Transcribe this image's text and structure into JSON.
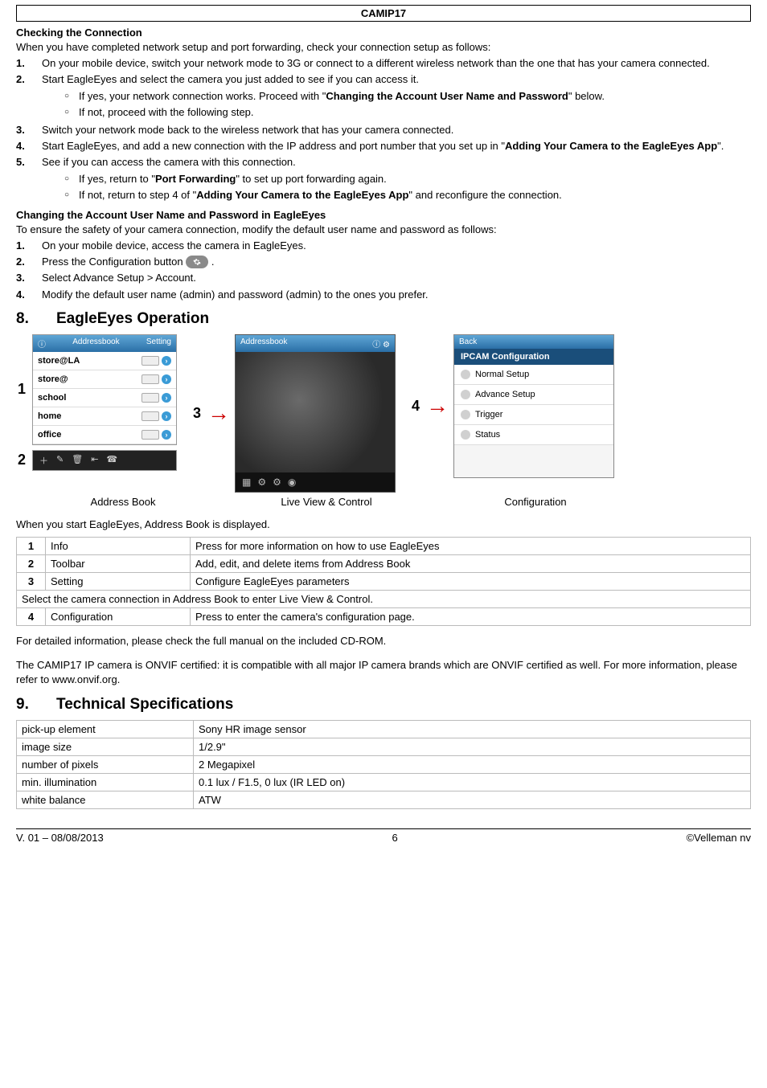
{
  "header": {
    "title": "CAMIP17"
  },
  "sectionA": {
    "title": "Checking the Connection",
    "intro": "When you have completed network setup and port forwarding, check your connection setup as follows:",
    "items": [
      {
        "n": "1.",
        "text": "On your mobile device, switch your network mode to 3G or connect to a different wireless network than the one that has your camera connected."
      },
      {
        "n": "2.",
        "text_before": "Start EagleEyes and select the camera you just added to see if you can access it.",
        "subs": [
          {
            "before": "If yes, your network connection works. Proceed with \"",
            "bold": "Changing the Account User Name and Password",
            "after": "\" below."
          },
          {
            "plain": "If not, proceed with the following step."
          }
        ]
      },
      {
        "n": "3.",
        "text": "Switch your network mode back to the wireless network that has your camera connected."
      },
      {
        "n": "4.",
        "text_before": "Start EagleEyes, and add a new connection with the IP address and port number that you set up in \"",
        "text_bold": "Adding Your Camera to the EagleEyes App",
        "text_after": "\"."
      },
      {
        "n": "5.",
        "text_before": "See if you can access the camera with this connection.",
        "subs": [
          {
            "before": "If yes, return to \"",
            "bold": "Port Forwarding",
            "after": "\" to set up port forwarding again."
          },
          {
            "before": "If not, return to step 4 of \"",
            "bold": "Adding Your Camera to the EagleEyes App",
            "after": "\" and reconfigure the connection."
          }
        ]
      }
    ]
  },
  "sectionB": {
    "title": "Changing the Account User Name and Password in EagleEyes",
    "intro": "To ensure the safety of your camera connection, modify the default user name and password as follows:",
    "items": [
      {
        "n": "1.",
        "text": "On your mobile device, access the camera in EagleEyes."
      },
      {
        "n": "2.",
        "text_before": "Press the Configuration button ",
        "has_icon": true,
        "text_after": "."
      },
      {
        "n": "3.",
        "text": "Select Advance Setup > Account."
      },
      {
        "n": "4.",
        "text": "Modify the default user name (admin) and password (admin) to the ones you prefer."
      }
    ]
  },
  "section8": {
    "num": "8.",
    "title": "EagleEyes Operation",
    "labels": {
      "l1": "1",
      "l2": "2",
      "l3": "3",
      "l4": "4"
    },
    "addressbook": {
      "title_left": "ⓘ",
      "title_mid": "Addressbook",
      "title_right": "Setting",
      "rows": [
        "store@LA",
        "store@",
        "school",
        "home",
        "office"
      ]
    },
    "liveview": {
      "title": "Addressbook"
    },
    "config": {
      "back": "Back",
      "hdr": "IPCAM Configuration",
      "items": [
        "Normal Setup",
        "Advance Setup",
        "Trigger",
        "Status"
      ]
    },
    "captions": {
      "c1": "Address Book",
      "c2": "Live View & Control",
      "c3": "Configuration"
    },
    "para": "When you start EagleEyes, Address Book is displayed.",
    "table": {
      "rows": [
        {
          "n": "1",
          "name": "Info",
          "desc": "Press for more information on how to use EagleEyes"
        },
        {
          "n": "2",
          "name": "Toolbar",
          "desc": "Add, edit, and delete items from Address Book"
        },
        {
          "n": "3",
          "name": "Setting",
          "desc": "Configure EagleEyes parameters"
        }
      ],
      "span": "Select the camera connection in Address Book to enter Live View & Control.",
      "last": {
        "n": "4",
        "name": "Configuration",
        "desc": "Press to enter the camera's configuration page."
      }
    },
    "after1": "For detailed information, please check the full manual on the included CD-ROM.",
    "after2": "The CAMIP17 IP camera is ONVIF certified: it is compatible with all major IP camera brands which are ONVIF certified as well. For more information, please refer to www.onvif.org."
  },
  "section9": {
    "num": "9.",
    "title": "Technical Specifications",
    "rows": [
      {
        "k": "pick-up element",
        "v": "Sony HR image sensor"
      },
      {
        "k": "image size",
        "v": "1/2.9\""
      },
      {
        "k": "number of pixels",
        "v": "2 Megapixel"
      },
      {
        "k": "min. illumination",
        "v": "0.1 lux / F1.5, 0 lux (IR LED on)"
      },
      {
        "k": "white balance",
        "v": "ATW"
      }
    ]
  },
  "footer": {
    "left": "V. 01 – 08/08/2013",
    "mid": "6",
    "right": "©Velleman nv"
  }
}
